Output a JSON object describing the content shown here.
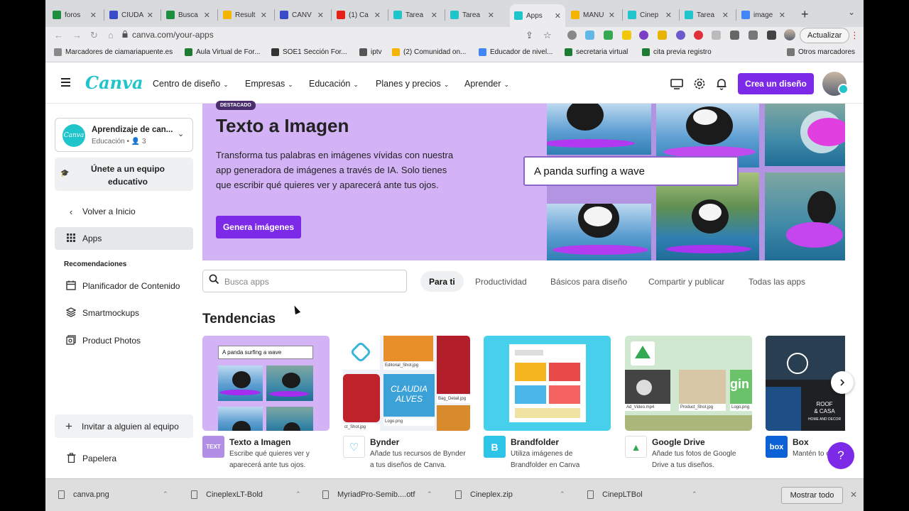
{
  "browser": {
    "tabs": [
      {
        "label": "foros",
        "color": "#1e8e3e",
        "active": false
      },
      {
        "label": "CIUDA",
        "color": "#3c4bc7",
        "active": false
      },
      {
        "label": "Busca",
        "color": "#1e8e3e",
        "active": false
      },
      {
        "label": "Result",
        "color": "#f4b400",
        "active": false
      },
      {
        "label": "CANV",
        "color": "#3c4bc7",
        "active": false
      },
      {
        "label": "(1) Ca",
        "color": "#e62117",
        "active": false
      },
      {
        "label": "Tarea",
        "color": "#20c4cb",
        "active": false
      },
      {
        "label": "Tarea",
        "color": "#20c4cb",
        "active": false
      },
      {
        "label": "Apps",
        "color": "#20c4cb",
        "active": true
      },
      {
        "label": "MANU",
        "color": "#f4b400",
        "active": false
      },
      {
        "label": "Cinep",
        "color": "#20c4cb",
        "active": false
      },
      {
        "label": "Tarea",
        "color": "#20c4cb",
        "active": false
      },
      {
        "label": "image",
        "color": "#4285f4",
        "active": false
      }
    ],
    "url": "canva.com/your-apps",
    "update_label": "Actualizar",
    "bookmarks": [
      {
        "label": "Marcadores de ciamariapuente.es",
        "color": "#888888"
      },
      {
        "label": "Aula Virtual de For...",
        "color": "#1e7b34"
      },
      {
        "label": "SOE1 Sección For...",
        "color": "#333333"
      },
      {
        "label": "iptv",
        "color": "#555555"
      },
      {
        "label": "(2) Comunidad on...",
        "color": "#f4b400"
      },
      {
        "label": "Educador de nivel...",
        "color": "#4285f4"
      },
      {
        "label": "secretaria virtual",
        "color": "#1e7b34"
      },
      {
        "label": "cita previa registro",
        "color": "#1e7b34"
      }
    ],
    "other_bookmarks": "Otros marcadores"
  },
  "header": {
    "logo": "Canva",
    "nav": [
      "Centro de diseño",
      "Empresas",
      "Educación",
      "Planes y precios",
      "Aprender"
    ],
    "create_label": "Crea un diseño"
  },
  "sidebar": {
    "team_name": "Aprendizaje de can...",
    "team_sub": "Educación • 👤 3",
    "team_logo": "Canva",
    "join_label": "Únete a un equipo educativo",
    "back_label": "Volver a Inicio",
    "apps_label": "Apps",
    "recommendations_heading": "Recomendaciones",
    "recommendations": [
      {
        "label": "Planificador de Contenido",
        "icon": "calendar-icon"
      },
      {
        "label": "Smartmockups",
        "icon": "layers-icon"
      },
      {
        "label": "Product Photos",
        "icon": "photos-icon"
      }
    ],
    "invite_label": "Invitar a alguien al equipo",
    "trash_label": "Papelera"
  },
  "banner": {
    "badge": "DESTACADO",
    "title": "Texto a Imagen",
    "description": "Transforma tus palabras en imágenes vívidas con nuestra app generadora de imágenes a través de IA. Solo tienes que escribir qué quieres ver y aparecerá ante tus ojos.",
    "button_label": "Genera imágenes",
    "prompt_text": "A panda surfing a wave"
  },
  "search": {
    "placeholder": "Busca apps",
    "value": ""
  },
  "filters": [
    "Para ti",
    "Productividad",
    "Básicos para diseño",
    "Compartir y publicar",
    "Todas las apps"
  ],
  "selected_filter": "Para ti",
  "section_title": "Tendencias",
  "apps": [
    {
      "name": "Texto a Imagen",
      "desc": "Escribe qué quieres ver y aparecerá ante tus ojos.",
      "icon_text": "TEXT",
      "icon_color": "#b28ee6",
      "thumb_prompt": "A panda surfing a wave"
    },
    {
      "name": "Bynder",
      "desc": "Añade tus recursos de Bynder a tus diseños de Canva.",
      "icon_text": "♡",
      "icon_color": "#ffffff",
      "thumb_labels": [
        "Editorial_Shot.jpg",
        "CLAUDIA",
        "ALVES",
        "Bag_Detail.jpg",
        "Logo.png",
        "ct_Shot.jpg"
      ]
    },
    {
      "name": "Brandfolder",
      "desc": "Utiliza imágenes de Brandfolder en Canva",
      "icon_text": "B",
      "icon_color": "#2ec4e8"
    },
    {
      "name": "Google Drive",
      "desc": "Añade tus fotos de Google Drive a tus diseños.",
      "icon_text": "▲",
      "icon_color": "#ffffff",
      "thumb_labels": [
        "Ad_Video.mp4",
        "Product_Shot.jpg",
        "Logo.png",
        "gin"
      ]
    },
    {
      "name": "Box",
      "desc": "Mantén to ordenados",
      "icon_text": "box",
      "icon_color": "#0b61d5",
      "thumb_labels": [
        "ROOF",
        "& CASA",
        "HOME AND DECOR"
      ]
    }
  ],
  "downloads": [
    {
      "name": "canva.png"
    },
    {
      "name": "CineplexLT-Bold"
    },
    {
      "name": "MyriadPro-Semib....otf"
    },
    {
      "name": "Cineplex.zip"
    },
    {
      "name": "CinepLTBol"
    }
  ],
  "show_all_label": "Mostrar todo",
  "help_label": "?"
}
